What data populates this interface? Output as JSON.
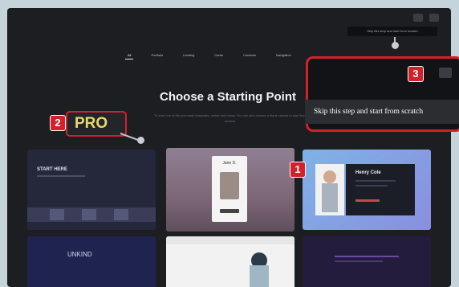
{
  "tooltip": {
    "label": "Skip this step and start from scratch"
  },
  "tabs": [
    "All",
    "Portfolio",
    "Landing",
    "Cards",
    "Contacts",
    "Navigation"
  ],
  "heading": {
    "title": "Choose a Starting Point",
    "subtitle": "To start one of the pre-made templates, select one below. You can also choose a blank canvas to start from scratch."
  },
  "callout": {
    "skip_label": "Skip this step and start from scratch",
    "badge": "3"
  },
  "pro": {
    "label": "PRO",
    "badge": "2"
  },
  "badge_one": "1",
  "cards": {
    "start_here": "START HERE",
    "jane": "Jane D.",
    "henry": "Henry Cole",
    "unkind": "UNKIND"
  },
  "colors": {
    "accent_red": "#d4202b",
    "pro_yellow": "#e8d86b",
    "window_bg": "#1d1e22"
  }
}
